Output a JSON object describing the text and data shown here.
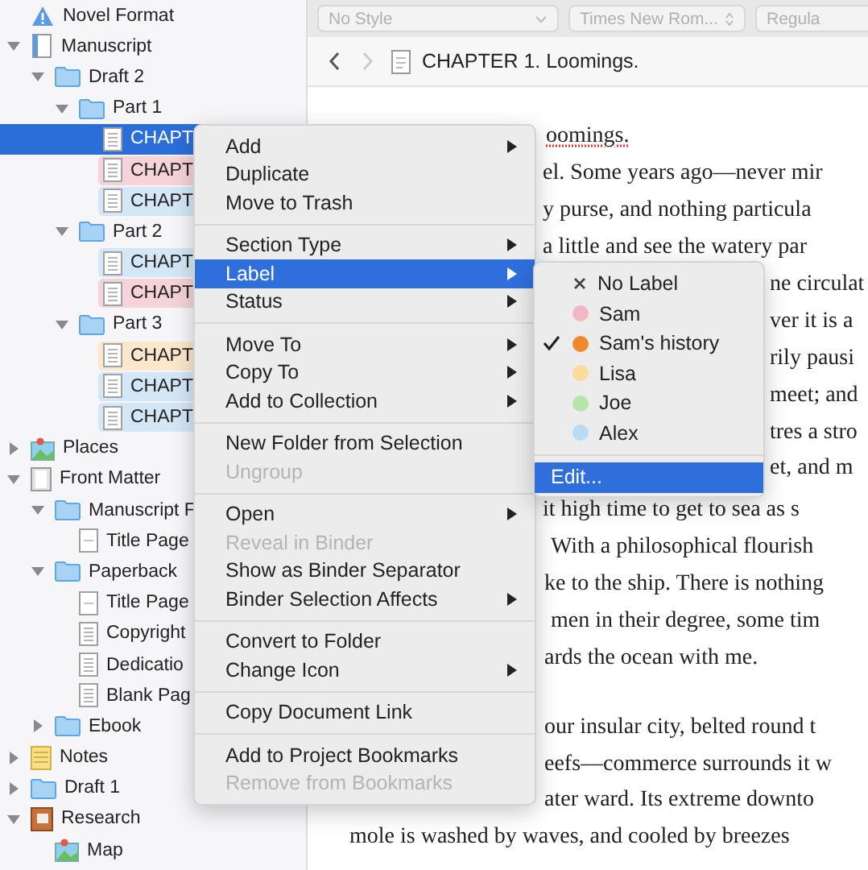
{
  "binder": {
    "items": [
      {
        "label": "Novel Format",
        "kind": "format",
        "selected": false
      },
      {
        "label": "Manuscript",
        "kind": "manuscript",
        "expanded": true,
        "selected": false,
        "children": [
          {
            "label": "Draft 2",
            "kind": "folder",
            "expanded": true,
            "selected": false,
            "children": [
              {
                "label": "Part 1",
                "kind": "folder",
                "expanded": true,
                "selected": false,
                "children": [
                  {
                    "label": "CHAPT",
                    "kind": "text",
                    "selected": true
                  },
                  {
                    "label": "CHAPT",
                    "kind": "text",
                    "selected": false,
                    "color": "#f5d3d8"
                  },
                  {
                    "label": "CHAPT",
                    "kind": "text",
                    "selected": false,
                    "color": "#d4e7f7"
                  }
                ]
              },
              {
                "label": "Part 2",
                "kind": "folder",
                "expanded": true,
                "selected": false,
                "children": [
                  {
                    "label": "CHAPT",
                    "kind": "text",
                    "selected": false,
                    "color": "#d4e7f7"
                  },
                  {
                    "label": "CHAPT",
                    "kind": "text",
                    "selected": false,
                    "color": "#f5d3d8"
                  }
                ]
              },
              {
                "label": "Part 3",
                "kind": "folder",
                "expanded": true,
                "selected": false,
                "children": [
                  {
                    "label": "CHAPT",
                    "kind": "text",
                    "selected": false,
                    "color": "#fbe7cc"
                  },
                  {
                    "label": "CHAPT",
                    "kind": "text",
                    "selected": false,
                    "color": "#d4e7f7"
                  },
                  {
                    "label": "CHAPT",
                    "kind": "text",
                    "selected": false,
                    "color": "#d4e7f7"
                  }
                ]
              }
            ]
          }
        ]
      },
      {
        "label": "Places",
        "kind": "picture",
        "expanded": false,
        "selected": false
      },
      {
        "label": "Front Matter",
        "kind": "frontmatter",
        "expanded": true,
        "selected": false,
        "children": [
          {
            "label": "Manuscript F",
            "kind": "folder",
            "expanded": true,
            "selected": false,
            "children": [
              {
                "label": "Title Page",
                "kind": "page",
                "selected": false
              }
            ]
          },
          {
            "label": "Paperback",
            "kind": "folder",
            "expanded": true,
            "selected": false,
            "children": [
              {
                "label": "Title Page",
                "kind": "page",
                "selected": false
              },
              {
                "label": "Copyright",
                "kind": "text",
                "selected": false
              },
              {
                "label": "Dedicatio",
                "kind": "text",
                "selected": false
              },
              {
                "label": "Blank Pag",
                "kind": "text",
                "selected": false
              }
            ]
          },
          {
            "label": "Ebook",
            "kind": "folder",
            "expanded": false,
            "selected": false
          }
        ]
      },
      {
        "label": "Notes",
        "kind": "notebook",
        "expanded": false,
        "selected": false
      },
      {
        "label": "Draft 1",
        "kind": "folder",
        "expanded": false,
        "selected": false
      },
      {
        "label": "Research",
        "kind": "research",
        "expanded": true,
        "selected": false,
        "children": [
          {
            "label": "Map",
            "kind": "picture",
            "selected": false
          }
        ]
      }
    ]
  },
  "format_bar": {
    "style_field": "No Style",
    "font_field": "Times New Rom...",
    "weight_field": "Regula"
  },
  "header": {
    "title": "CHAPTER 1. Loomings."
  },
  "editor": {
    "lines": [
      {
        "text": "oomings.",
        "misspelled": true
      },
      {
        "text": "el. Some years ago—never mir",
        "misspelled": false
      },
      {
        "text": "y purse, and nothing particula",
        "misspelled": false
      },
      {
        "text": "a little and see the watery par",
        "misspelled": false
      },
      {
        "text": "ne circulat",
        "misspelled": false
      },
      {
        "text": "ver it is a",
        "misspelled": false
      },
      {
        "text": "rily pausi",
        "misspelled": false
      },
      {
        "text": "meet; and",
        "misspelled": false
      },
      {
        "text": "tres a stro",
        "misspelled": false
      },
      {
        "text": "et, and m",
        "misspelled": false
      },
      {
        "text": "it high time to get to sea as s",
        "misspelled": false
      },
      {
        "text": "With a philosophical flourish",
        "misspelled": false
      },
      {
        "text": "ke to the ship. There is nothing",
        "misspelled": false
      },
      {
        "text": "men in their degree, some tim",
        "misspelled": false
      },
      {
        "text": "ards the ocean with me.",
        "misspelled": false
      },
      {
        "text": "our insular city, belted round t",
        "misspelled": false
      },
      {
        "text": "eefs—commerce surrounds it w",
        "misspelled": false
      },
      {
        "text": "ater ward. Its extreme downto",
        "misspelled": false
      },
      {
        "text": "mole is washed by waves, and cooled by breezes",
        "misspelled": false
      }
    ]
  },
  "context_menu": {
    "sections": [
      {
        "items": [
          {
            "label": "Add",
            "submenu": true,
            "disabled": false,
            "highlighted": false
          },
          {
            "label": "Duplicate",
            "submenu": false,
            "disabled": false,
            "highlighted": false
          },
          {
            "label": "Move to Trash",
            "submenu": false,
            "disabled": false,
            "highlighted": false
          }
        ]
      },
      {
        "items": [
          {
            "label": "Section Type",
            "submenu": true,
            "disabled": false,
            "highlighted": false
          },
          {
            "label": "Label",
            "submenu": true,
            "disabled": false,
            "highlighted": true
          },
          {
            "label": "Status",
            "submenu": true,
            "disabled": false,
            "highlighted": false
          }
        ]
      },
      {
        "items": [
          {
            "label": "Move To",
            "submenu": true,
            "disabled": false,
            "highlighted": false
          },
          {
            "label": "Copy To",
            "submenu": true,
            "disabled": false,
            "highlighted": false
          },
          {
            "label": "Add to Collection",
            "submenu": true,
            "disabled": false,
            "highlighted": false
          }
        ]
      },
      {
        "items": [
          {
            "label": "New Folder from Selection",
            "submenu": false,
            "disabled": false,
            "highlighted": false
          },
          {
            "label": "Ungroup",
            "submenu": false,
            "disabled": true,
            "highlighted": false
          }
        ]
      },
      {
        "items": [
          {
            "label": "Open",
            "submenu": true,
            "disabled": false,
            "highlighted": false
          },
          {
            "label": "Reveal in Binder",
            "submenu": false,
            "disabled": true,
            "highlighted": false
          },
          {
            "label": "Show as Binder Separator",
            "submenu": false,
            "disabled": false,
            "highlighted": false
          },
          {
            "label": "Binder Selection Affects",
            "submenu": true,
            "disabled": false,
            "highlighted": false
          }
        ]
      },
      {
        "items": [
          {
            "label": "Convert to Folder",
            "submenu": false,
            "disabled": false,
            "highlighted": false
          },
          {
            "label": "Change Icon",
            "submenu": true,
            "disabled": false,
            "highlighted": false
          }
        ]
      },
      {
        "items": [
          {
            "label": "Copy Document Link",
            "submenu": false,
            "disabled": false,
            "highlighted": false
          }
        ]
      },
      {
        "items": [
          {
            "label": "Add to Project Bookmarks",
            "submenu": false,
            "disabled": false,
            "highlighted": false
          },
          {
            "label": "Remove from Bookmarks",
            "submenu": false,
            "disabled": true,
            "highlighted": false
          }
        ]
      }
    ]
  },
  "label_menu": {
    "items": [
      {
        "kind": "none",
        "label": "No Label",
        "checked": false,
        "highlighted": false
      },
      {
        "kind": "color",
        "label": "Sam",
        "color": "#f3b7c3",
        "checked": false,
        "highlighted": false
      },
      {
        "kind": "color",
        "label": "Sam's history",
        "color": "#f0892a",
        "checked": true,
        "highlighted": false
      },
      {
        "kind": "color",
        "label": "Lisa",
        "color": "#fadb9a",
        "checked": false,
        "highlighted": false
      },
      {
        "kind": "color",
        "label": "Joe",
        "color": "#b6e5a9",
        "checked": false,
        "highlighted": false
      },
      {
        "kind": "color",
        "label": "Alex",
        "color": "#b9dcf4",
        "checked": false,
        "highlighted": false
      }
    ],
    "actions": [
      {
        "label": "Edit...",
        "highlighted": true
      }
    ]
  }
}
